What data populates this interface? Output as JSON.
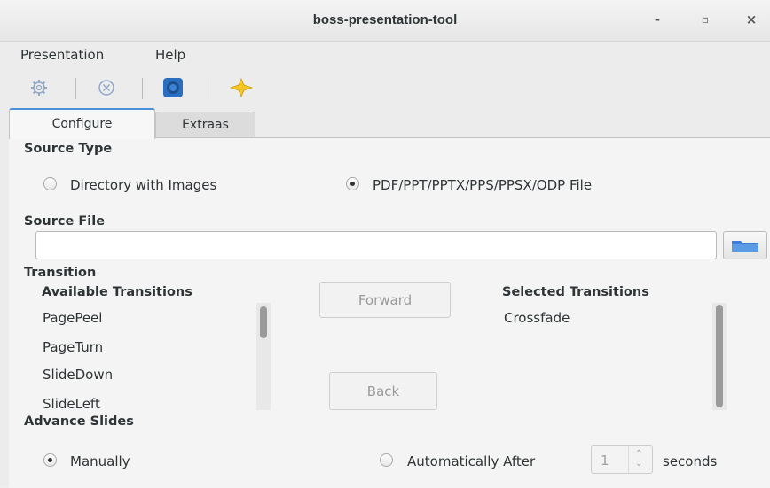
{
  "window": {
    "title": "boss-presentation-tool",
    "minimize": "-",
    "maximize": "▫",
    "close": "×"
  },
  "menubar": [
    "Presentation",
    "Help"
  ],
  "toolbar": {
    "icons": [
      "gear-icon",
      "cancel-circle-icon",
      "help-icon",
      "star-icon"
    ]
  },
  "tabs": [
    "Configure",
    "Extraas"
  ],
  "source_type": {
    "heading": "Source Type",
    "options": [
      "Directory with Images",
      "PDF/PPT/PPTX/PPS/PPSX/ODP File"
    ],
    "selected": "PDF/PPT/PPTX/PPS/PPSX/ODP File"
  },
  "source_file": {
    "heading": "Source File",
    "value": ""
  },
  "transition": {
    "heading": "Transition",
    "available_heading": "Available Transitions",
    "available": [
      "PagePeel",
      "PageTurn",
      "SlideDown",
      "SlideLeft"
    ],
    "selected_heading": "Selected Transitions",
    "selected": [
      "Crossfade"
    ],
    "forward_label": "Forward",
    "back_label": "Back"
  },
  "advance": {
    "heading": "Advance Slides",
    "manual_label": "Manually",
    "auto_label": "Automatically After",
    "selected": "Manually",
    "seconds_value": "1",
    "seconds_label": "seconds"
  },
  "colors": {
    "accent": "#4a90d9",
    "help_icon": "#2a6fbf",
    "star_icon": "#f3c623",
    "folder_icon": "#3b7dd8"
  }
}
